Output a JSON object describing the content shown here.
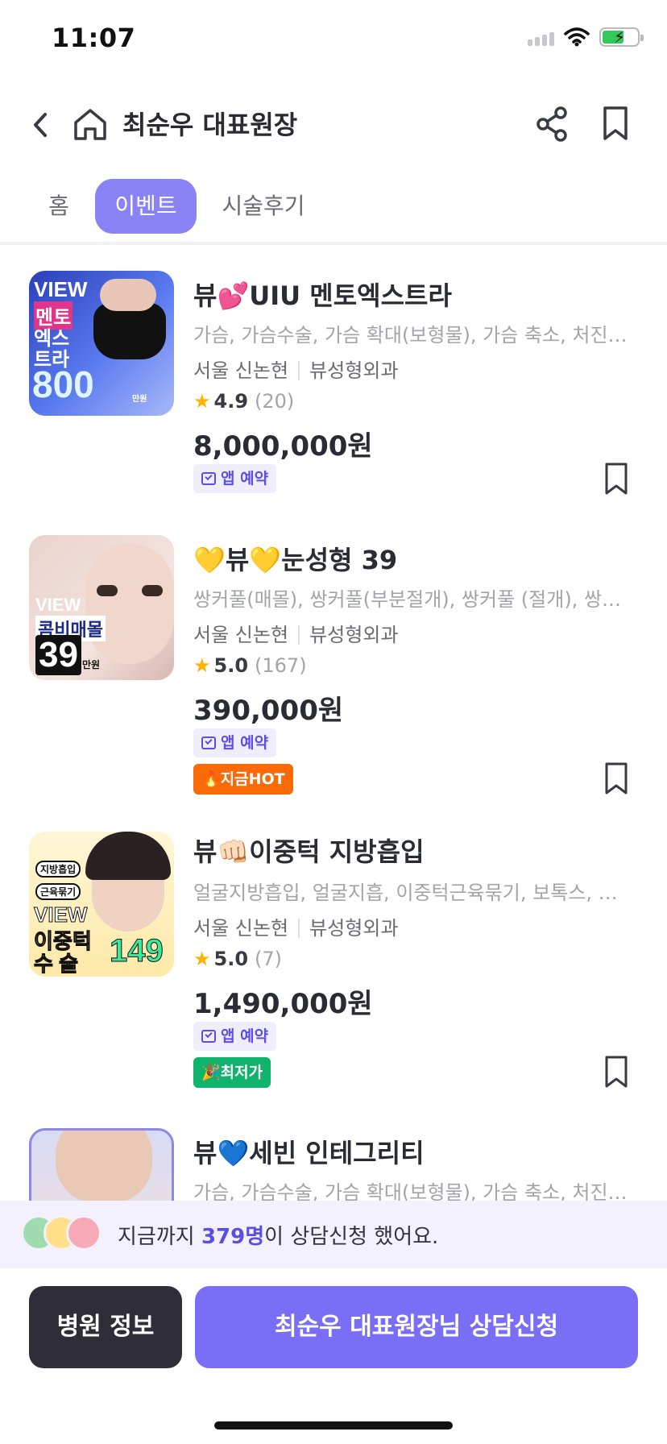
{
  "status_bar": {
    "time": "11:07"
  },
  "header": {
    "title": "최순우 대표원장"
  },
  "tabs": [
    {
      "label": "홈",
      "active": false
    },
    {
      "label": "이벤트",
      "active": true
    },
    {
      "label": "시술후기",
      "active": false
    }
  ],
  "events": [
    {
      "title": "뷰💕UIU 멘토엑스트라",
      "tags": "가슴, 가슴수술, 가슴 확대(보형물), 가슴 축소, 처진가슴 교정",
      "city": "서울 신논현",
      "clinic": "뷰성형외과",
      "rating": "4.9",
      "review_count": "(20)",
      "price": "8,000,000원",
      "app_badge": "앱 예약",
      "thumb": {
        "line1": "VIEW",
        "line2": "멘토",
        "line3": "엑스",
        "line4": "트라",
        "line5": "800",
        "unit": "만원"
      }
    },
    {
      "title": "💛뷰💛눈성형 39",
      "tags": "쌍커풀(매몰), 쌍커풀(부분절개), 쌍커풀 (절개), 쌍커풀 재수술",
      "city": "서울 신논현",
      "clinic": "뷰성형외과",
      "rating": "5.0",
      "review_count": "(167)",
      "price": "390,000원",
      "app_badge": "앱 예약",
      "extra_badge": "🔥지금HOT",
      "thumb": {
        "line1": "VIEW",
        "line2": "콤비매몰",
        "line3": "39",
        "unit": "만원"
      }
    },
    {
      "title": "뷰👊🏻이중턱 지방흡입",
      "tags": "얼굴지방흡입, 얼굴지흡, 이중턱근육묶기, 보톡스, 필러",
      "city": "서울 신논현",
      "clinic": "뷰성형외과",
      "rating": "5.0",
      "review_count": "(7)",
      "price": "1,490,000원",
      "app_badge": "앱 예약",
      "extra_badge": "🎉최저가",
      "thumb": {
        "line1": "지방흡입",
        "line2": "근육묶기",
        "line3": "VIEW",
        "line4": "이중턱",
        "line5": "수 술",
        "num": "149"
      }
    },
    {
      "title": "뷰💙세빈 인테그리티",
      "tags": "가슴, 가슴수술, 가슴 확대(보형물), 가슴 축소, 처진가슴 교정"
    }
  ],
  "consult_banner": {
    "prefix": "지금까지 ",
    "count": "379명",
    "suffix": "이 상담신청 했어요."
  },
  "buttons": {
    "hospital_info": "병원 정보",
    "consult": "최순우 대표원장님 상담신청"
  },
  "colors": {
    "accent": "#7a6ef6",
    "tab_active": "#8a82f5",
    "hot": "#fb6a08",
    "lowest": "#10b36b",
    "star": "#ffb200"
  }
}
